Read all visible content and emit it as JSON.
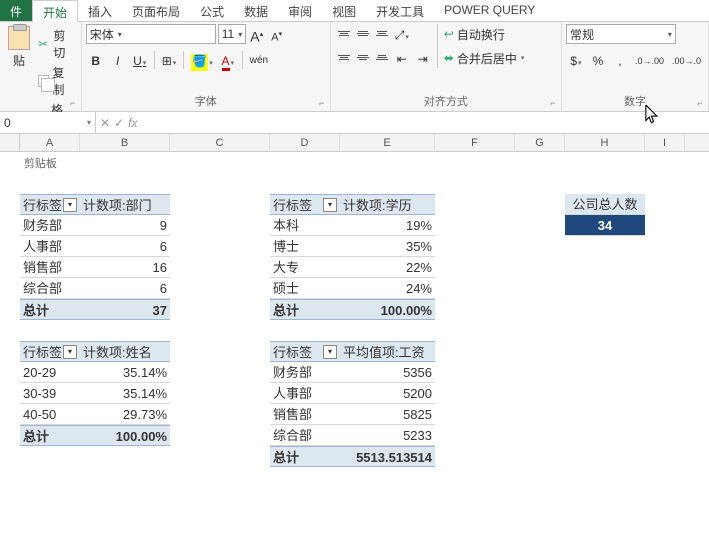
{
  "tabs": {
    "file": "件",
    "home": "开始",
    "insert": "插入",
    "layout": "页面布局",
    "formulas": "公式",
    "data": "数据",
    "review": "审阅",
    "view": "视图",
    "developer": "开发工具",
    "powerquery": "POWER QUERY"
  },
  "clipboard": {
    "paste": "贴",
    "cut": "剪切",
    "copy": "复制",
    "painter": "格式刷",
    "label": "剪贴板"
  },
  "font": {
    "name": "宋体",
    "size": "11",
    "grow": "A",
    "shrink": "A",
    "bold": "B",
    "italic": "I",
    "underline": "U",
    "ruby": "wén",
    "label": "字体"
  },
  "alignment": {
    "wrap": "自动换行",
    "merge": "合并后居中",
    "label": "对齐方式"
  },
  "number": {
    "format": "常规",
    "percent": "%",
    "comma": ",",
    "inc": ".0",
    "dec": ".00",
    "label": "数字"
  },
  "namebox": "0",
  "columns": [
    "A",
    "B",
    "C",
    "D",
    "E",
    "F",
    "G",
    "H",
    "I"
  ],
  "pivot1": {
    "row_label": "行标签",
    "val_label": "计数项:部门",
    "rows": [
      {
        "k": "财务部",
        "v": "9"
      },
      {
        "k": "人事部",
        "v": "6"
      },
      {
        "k": "销售部",
        "v": "16"
      },
      {
        "k": "综合部",
        "v": "6"
      }
    ],
    "total_k": "总计",
    "total_v": "37"
  },
  "pivot2": {
    "row_label": "行标签",
    "val_label": "计数项:姓名",
    "rows": [
      {
        "k": "20-29",
        "v": "35.14%"
      },
      {
        "k": "30-39",
        "v": "35.14%"
      },
      {
        "k": "40-50",
        "v": "29.73%"
      }
    ],
    "total_k": "总计",
    "total_v": "100.00%"
  },
  "pivot3": {
    "row_label": "行标签",
    "val_label": "计数项:学历",
    "rows": [
      {
        "k": "本科",
        "v": "19%"
      },
      {
        "k": "博士",
        "v": "35%"
      },
      {
        "k": "大专",
        "v": "22%"
      },
      {
        "k": "硕士",
        "v": "24%"
      }
    ],
    "total_k": "总计",
    "total_v": "100.00%"
  },
  "pivot4": {
    "row_label": "行标签",
    "val_label": "平均值项:工资",
    "rows": [
      {
        "k": "财务部",
        "v": "5356"
      },
      {
        "k": "人事部",
        "v": "5200"
      },
      {
        "k": "销售部",
        "v": "5825"
      },
      {
        "k": "综合部",
        "v": "5233"
      }
    ],
    "total_k": "总计",
    "total_v": "5513.513514"
  },
  "summary": {
    "label": "公司总人数",
    "value": "34"
  }
}
